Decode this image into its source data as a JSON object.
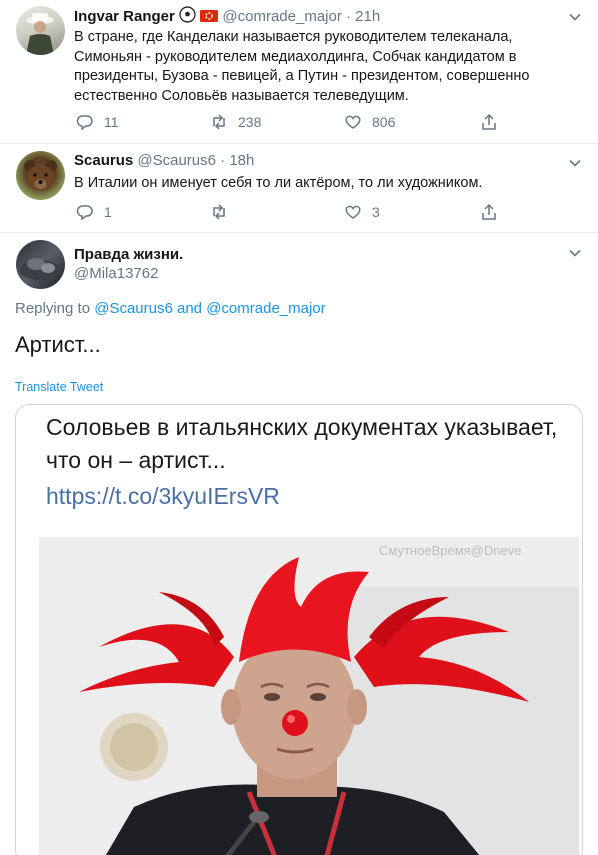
{
  "tweets": [
    {
      "name": "Ingvar Ranger",
      "handle": "@comrade_major",
      "time": "21h",
      "text": "В стране, где Канделаки называется руководителем телеканала, Симоньян - руководителем медиахолдинга, Собчак кандидатом в президенты, Бузова - певицей, а Путин - президентом, совершенно естественно Соловьёв называется телеведущим.",
      "replies": "11",
      "retweets": "238",
      "likes": "806"
    },
    {
      "name": "Scaurus",
      "handle": "@Scaurus6",
      "time": "18h",
      "text": "В Италии он именует себя то ли актёром, то ли художником.",
      "replies": "1",
      "retweets": "",
      "likes": "3"
    }
  ],
  "main_tweet": {
    "name": "Правда жизни.",
    "handle": "@Mila13762",
    "replying_prefix": "Replying to",
    "reply_to_1": "@Scaurus6",
    "reply_and": "and",
    "reply_to_2": "@comrade_major",
    "text": "Артист...",
    "translate_label": "Translate Tweet",
    "card": {
      "title": "Соловьев в итальянских документах указывает, что он – артист...",
      "link": "https://t.co/3kyuIErsVR",
      "watermark": "СмутноеВремя@Dneve"
    }
  },
  "colors": {
    "accent": "#1b95e0",
    "secondary_text": "#657786",
    "divider": "#e6ecf0"
  },
  "icons": [
    "reply-icon",
    "retweet-icon",
    "like-icon",
    "share-icon",
    "chevron-down-icon",
    "soccer-ball-icon",
    "hong-kong-flag-icon"
  ]
}
